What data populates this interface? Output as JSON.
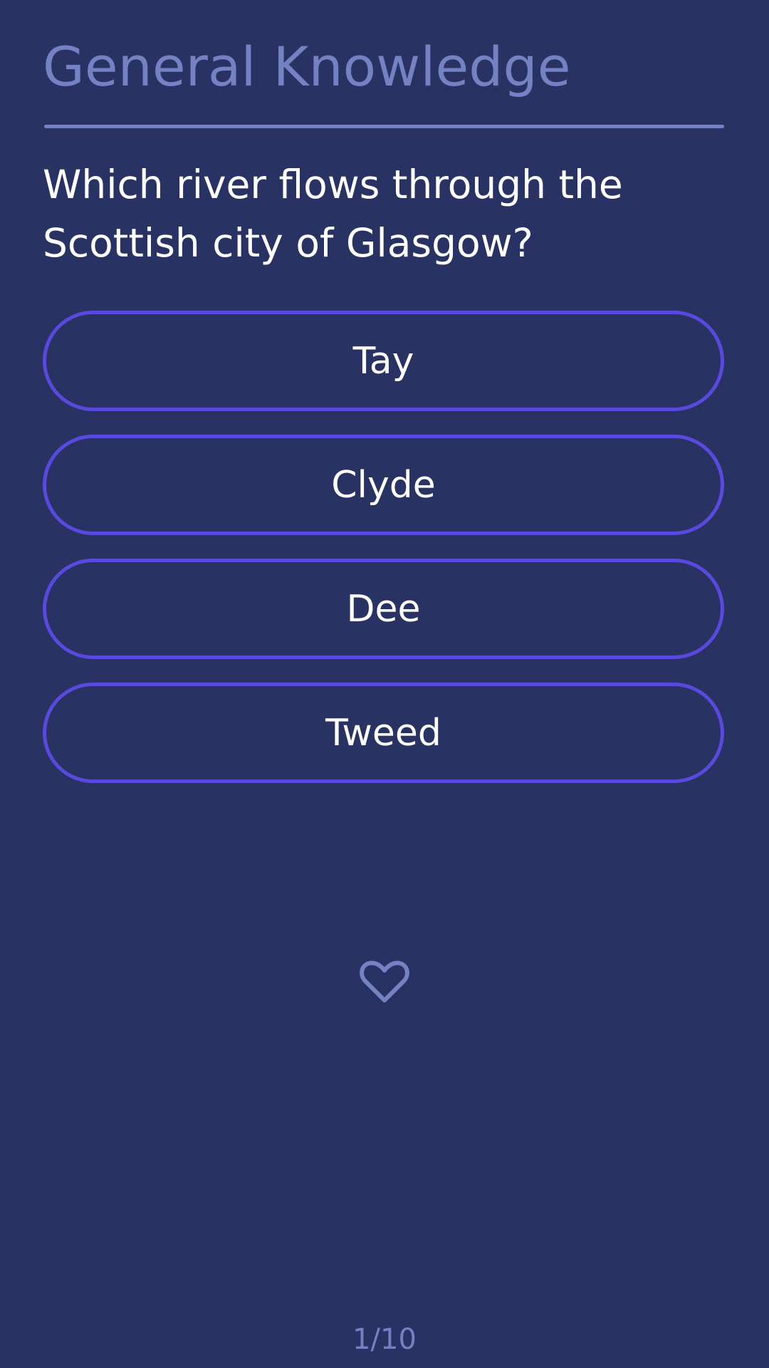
{
  "header": {
    "category": "General Knowledge"
  },
  "question": {
    "text": "Which river flows through the Scottish city of Glasgow?"
  },
  "answers": [
    {
      "label": "Tay"
    },
    {
      "label": "Clyde"
    },
    {
      "label": "Dee"
    },
    {
      "label": "Tweed"
    }
  ],
  "favorite": {
    "icon": "heart-outline-icon",
    "selected": false
  },
  "progress": {
    "text": "1/10",
    "current": 1,
    "total": 10
  },
  "colors": {
    "background": "#283263",
    "muted_text": "#7481c3",
    "button_border": "#5a49de",
    "text": "#ffffff"
  }
}
